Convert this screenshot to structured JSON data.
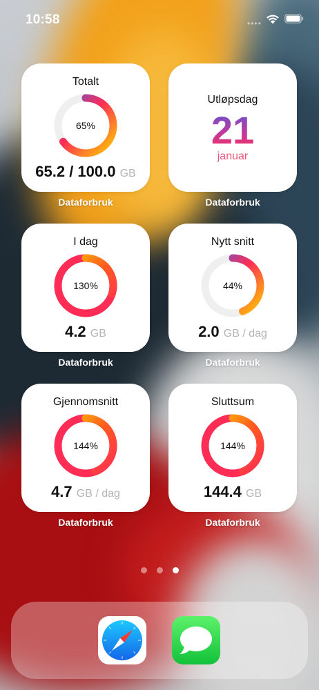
{
  "status_bar": {
    "time": "10:58",
    "wifi_icon": "wifi-icon",
    "battery_icon": "battery-icon"
  },
  "colors": {
    "ring_track": "#efefef",
    "gradient_start": "#ff2d55",
    "gradient_mid": "#ff5a1f",
    "gradient_end": "#ffcc00",
    "purple": "#5856d6"
  },
  "widgets": [
    {
      "title": "Totalt",
      "percent_label": "65%",
      "percent": 65,
      "value": "65.2 / 100.0",
      "unit": "GB",
      "caption": "Dataforbruk"
    },
    {
      "title": "Utløpsdag",
      "day": "21",
      "month": "januar",
      "caption": "Dataforbruk"
    },
    {
      "title": "I dag",
      "percent_label": "130%",
      "percent": 130,
      "value": "4.2",
      "unit": "GB",
      "caption": "Dataforbruk"
    },
    {
      "title": "Nytt snitt",
      "percent_label": "44%",
      "percent": 44,
      "value": "2.0",
      "unit": "GB / dag",
      "caption": "Dataforbruk"
    },
    {
      "title": "Gjennomsnitt",
      "percent_label": "144%",
      "percent": 144,
      "value": "4.7",
      "unit": "GB / dag",
      "caption": "Dataforbruk"
    },
    {
      "title": "Sluttsum",
      "percent_label": "144%",
      "percent": 144,
      "value": "144.4",
      "unit": "GB",
      "caption": "Dataforbruk"
    }
  ],
  "page_indicator": {
    "pages": 3,
    "current": 3
  },
  "dock": [
    {
      "name": "Safari",
      "icon": "compass-icon"
    },
    {
      "name": "Messages",
      "icon": "speech-bubble-icon"
    }
  ]
}
